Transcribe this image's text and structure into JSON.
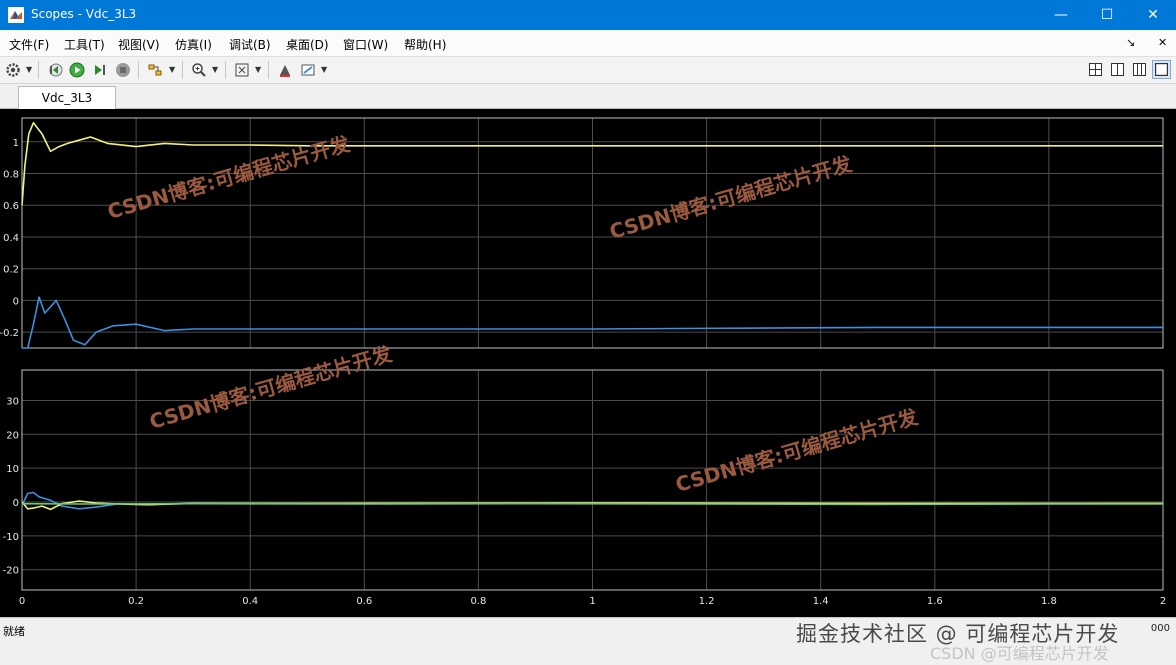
{
  "window": {
    "title": "Scopes - Vdc_3L3",
    "controls": {
      "minimize": "—",
      "maximize": "☐",
      "close": "✕"
    }
  },
  "menu": [
    "文件(F)",
    "工具(T)",
    "视图(V)",
    "仿真(I)",
    "调试(B)",
    "桌面(D)",
    "窗口(W)",
    "帮助(H)"
  ],
  "menu_extras": {
    "pin": "↘",
    "close": "✕"
  },
  "toolbar_icons": [
    "gear-icon",
    "step-back-icon",
    "run-icon",
    "step-forward-icon",
    "stop-icon",
    "signal-select-icon",
    "zoom-in-icon",
    "fit-axes-icon",
    "highlight-icon",
    "style-icon",
    "layout-2x2-icon",
    "layout-1x2-icon",
    "layout-2x1-icon",
    "layout-single-icon"
  ],
  "tab": {
    "label": "Vdc_3L3"
  },
  "colors": {
    "yellow": "#f2f27a",
    "blue": "#3d8fe0",
    "green": "#6fc86f",
    "grid": "#4d4d4d",
    "axis": "#bfbfbf",
    "tick": "#e6e6e6",
    "watermark": "#9b5a3f"
  },
  "chart_data": [
    {
      "type": "line",
      "xlim": [
        0,
        2
      ],
      "ylim": [
        -0.3,
        1.15
      ],
      "y_ticks": [
        "1",
        "0.8",
        "0.6",
        "0.4",
        "0.2",
        "0",
        "-0.2"
      ],
      "y_tick_values": [
        1,
        0.8,
        0.6,
        0.4,
        0.2,
        0,
        -0.2
      ],
      "grid": true,
      "series": [
        {
          "color": "#f2f27a",
          "x": [
            0,
            0.005,
            0.012,
            0.02,
            0.035,
            0.05,
            0.065,
            0.08,
            0.1,
            0.12,
            0.15,
            0.2,
            0.25,
            0.3,
            0.4,
            0.5,
            1.0,
            1.5,
            2.0
          ],
          "y": [
            0.6,
            0.85,
            1.05,
            1.12,
            1.05,
            0.94,
            0.97,
            0.99,
            1.01,
            1.03,
            0.99,
            0.97,
            0.99,
            0.98,
            0.98,
            0.975,
            0.975,
            0.975,
            0.975
          ]
        },
        {
          "color": "#3d8fe0",
          "x": [
            0,
            0.01,
            0.02,
            0.03,
            0.04,
            0.05,
            0.06,
            0.075,
            0.09,
            0.11,
            0.13,
            0.16,
            0.2,
            0.25,
            0.3,
            0.4,
            0.6,
            1.0,
            1.5,
            2.0
          ],
          "y": [
            -0.3,
            -0.3,
            -0.15,
            0.02,
            -0.08,
            -0.04,
            0.0,
            -0.12,
            -0.25,
            -0.28,
            -0.2,
            -0.16,
            -0.15,
            -0.19,
            -0.18,
            -0.18,
            -0.18,
            -0.18,
            -0.17,
            -0.17
          ]
        }
      ]
    },
    {
      "type": "line",
      "xlim": [
        0,
        2
      ],
      "ylim": [
        -26,
        39
      ],
      "x_ticks": [
        "0",
        "0.2",
        "0.4",
        "0.6",
        "0.8",
        "1",
        "1.2",
        "1.4",
        "1.6",
        "1.8",
        "2"
      ],
      "x_tick_values": [
        0,
        0.2,
        0.4,
        0.6,
        0.8,
        1,
        1.2,
        1.4,
        1.6,
        1.8,
        2
      ],
      "y_ticks": [
        "30",
        "20",
        "10",
        "0",
        "-10",
        "-20"
      ],
      "y_tick_values": [
        30,
        20,
        10,
        0,
        -10,
        -20
      ],
      "grid": true,
      "series": [
        {
          "color": "#3d8fe0",
          "x": [
            0,
            0.01,
            0.02,
            0.03,
            0.05,
            0.07,
            0.1,
            0.13,
            0.17,
            0.22,
            0.3,
            0.5,
            1.0,
            1.5,
            2.0
          ],
          "y": [
            -1,
            2.5,
            2.8,
            1.5,
            0.5,
            -1.2,
            -2,
            -1.5,
            -0.5,
            -0.8,
            -0.3,
            -0.5,
            -0.4,
            -0.6,
            -0.5
          ]
        },
        {
          "color": "#f2f27a",
          "x": [
            0,
            0.01,
            0.02,
            0.035,
            0.05,
            0.07,
            0.1,
            0.13,
            0.17,
            0.22,
            0.3,
            0.5,
            1.0,
            1.5,
            2.0
          ],
          "y": [
            0,
            -2,
            -1.8,
            -1.2,
            -2.2,
            -0.5,
            0.3,
            -0.3,
            -0.6,
            -0.8,
            -0.4,
            -0.4,
            -0.3,
            -0.4,
            -0.4
          ]
        },
        {
          "color": "#6fc86f",
          "x": [
            0,
            0.1,
            0.3,
            0.6,
            0.9,
            1.2,
            1.5,
            1.8,
            2.0
          ],
          "y": [
            -0.5,
            -0.6,
            -0.5,
            -0.6,
            -0.5,
            -0.6,
            -0.7,
            -0.6,
            -0.6
          ]
        }
      ]
    }
  ],
  "watermarks": [
    "CSDN博客:可编程芯片开发",
    "CSDN博客:可编程芯片开发",
    "CSDN博客:可编程芯片开发",
    "CSDN博客:可编程芯片开发"
  ],
  "status": {
    "text": "就绪",
    "right_value": "000"
  },
  "bottom_watermarks": {
    "juejin": "掘金技术社区 @ 可编程芯片开发",
    "csdn": "CSDN @可编程芯片开发"
  }
}
